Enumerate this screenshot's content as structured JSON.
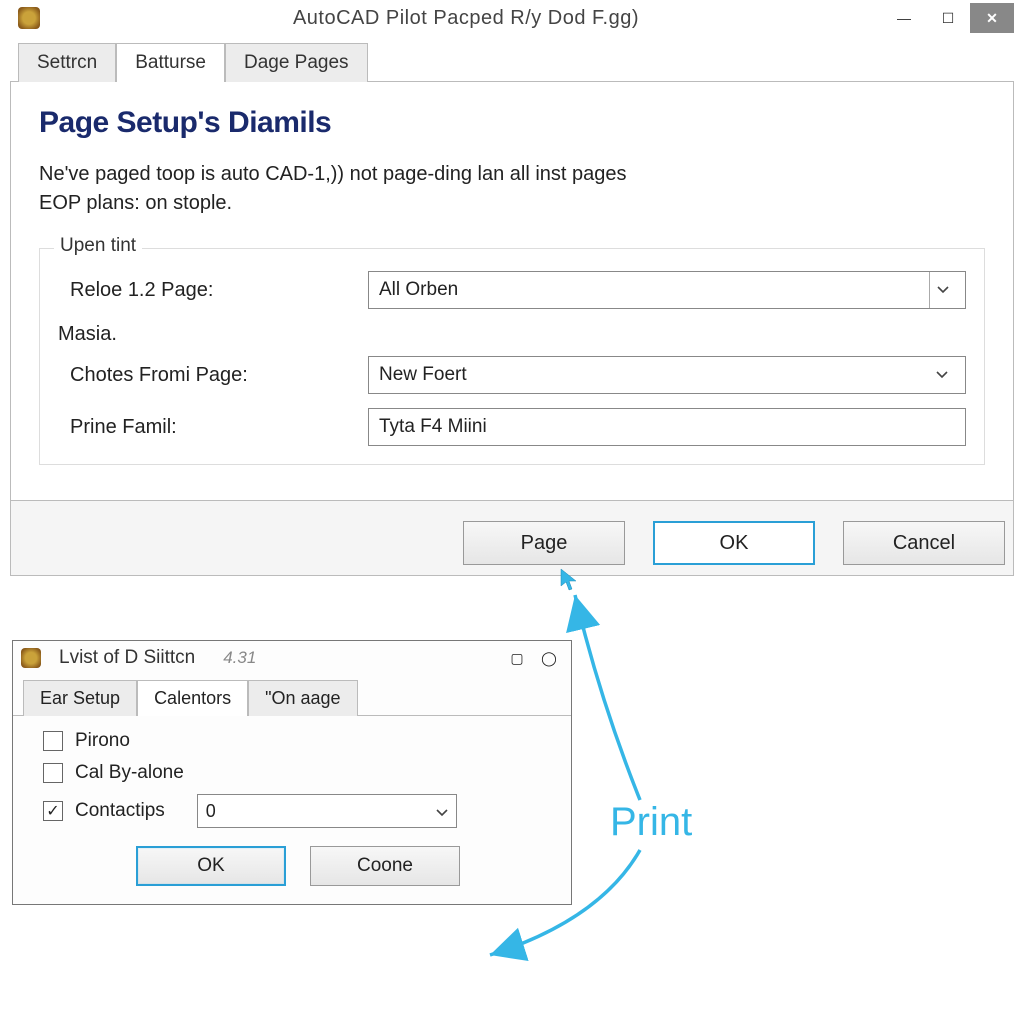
{
  "dialog1": {
    "title": "AutoCAD Pilot Pacped R/y Dod F.gg)",
    "tabs": [
      "Settrcn",
      "Batturse",
      "Dage Pages"
    ],
    "active_tab": 1,
    "section_title": "Page Setup's Diamils",
    "body_text_line1": "Ne've paged toop is auto CAD-1,)) not page-ding lan all inst pages",
    "body_text_line2": "EOP plans: on stople.",
    "group_legend": "Upen tint",
    "field1_label": "Reloe 1.2 Page:",
    "field1_value": "All Orben",
    "inline_label": "Masia.",
    "field2_label": "Chotes Fromi Page:",
    "field2_value": "New Foert",
    "field3_label": "Prine Famil:",
    "field3_value": "Tyta F4 Miini",
    "buttons": {
      "page": "Page",
      "ok": "OK",
      "cancel": "Cancel"
    }
  },
  "dialog2": {
    "title": "Lvist of D Siittcn",
    "version": "4.31",
    "tabs": [
      "Ear Setup",
      "Calentors",
      "\"On aage"
    ],
    "active_tab": 1,
    "checks": [
      {
        "label": "Pirono",
        "checked": false
      },
      {
        "label": "Cal By-alone",
        "checked": false
      },
      {
        "label": "Contactips",
        "checked": true
      }
    ],
    "select_value": "0",
    "buttons": {
      "ok": "OK",
      "coone": "Coone"
    }
  },
  "annotation": {
    "label": "Print"
  }
}
